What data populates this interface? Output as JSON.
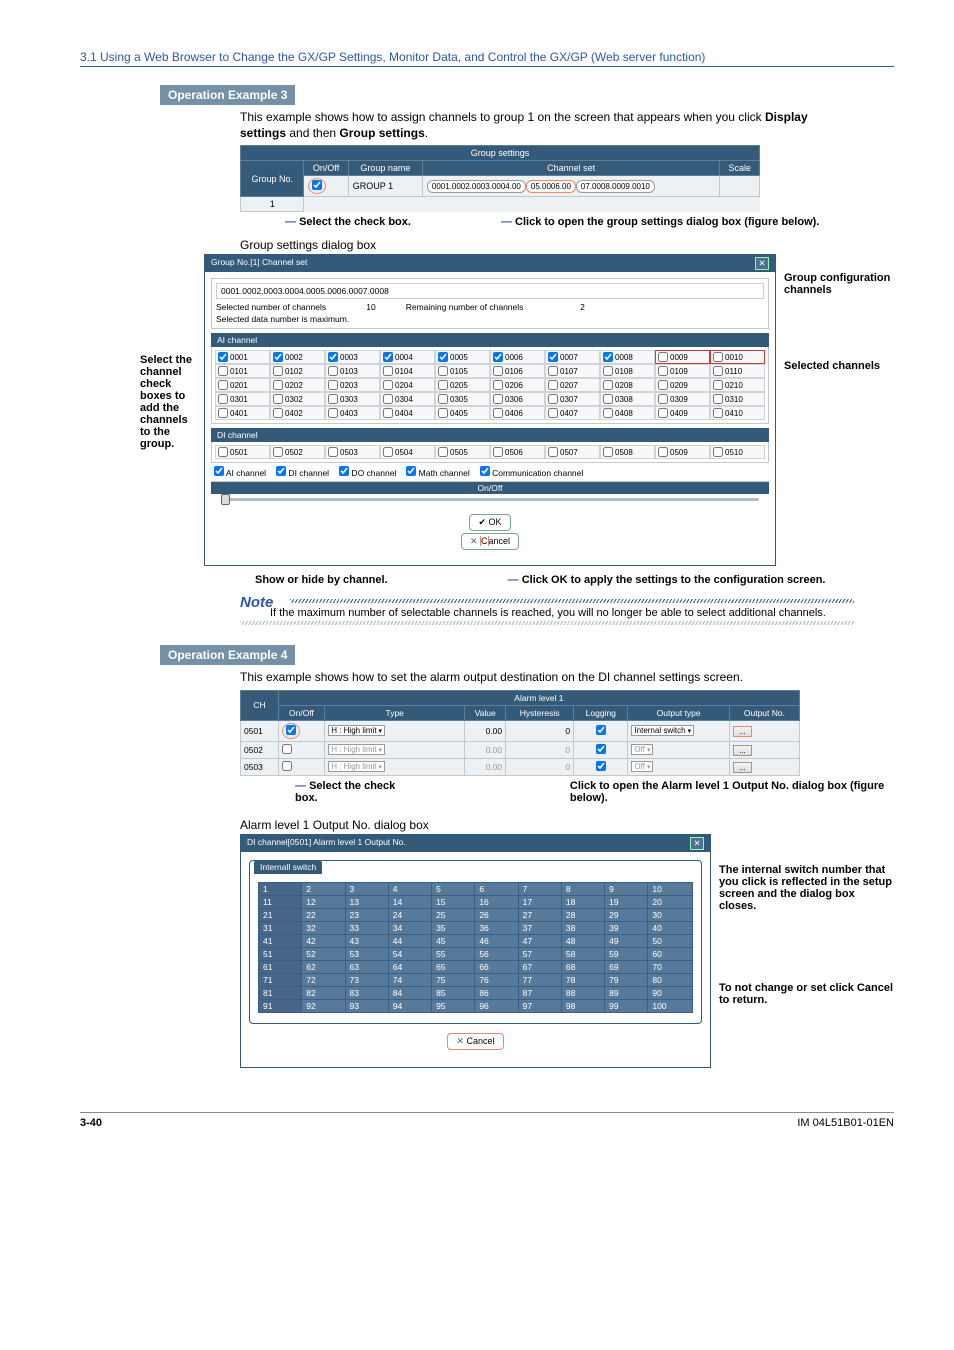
{
  "breadcrumb": "3.1  Using a Web Browser to Change the GX/GP Settings, Monitor Data, and Control the GX/GP (Web server function)",
  "ex3": {
    "header": "Operation Example 3",
    "intro_a": "This example shows how to assign channels to group 1 on the screen that appears when you click ",
    "intro_b": "Display settings",
    "intro_c": " and then ",
    "intro_d": "Group settings",
    "intro_e": ".",
    "top_table": {
      "title": "Group settings",
      "cols": [
        "Group No.",
        "On/Off",
        "Group name",
        "Channel set",
        "Scale"
      ],
      "row": {
        "no": "1",
        "name": "GROUP 1",
        "chan_a": "0001.0002.0003.0004.00",
        "chan_b": "05.0006.00",
        "chan_c": "07.0008.0009.0010"
      }
    },
    "callout_select": "Select the check box.",
    "callout_click": "Click to open the group settings dialog box (figure below).",
    "dialog_caption": "Group settings dialog box",
    "side_label": "Select the channel check boxes to add the channels to the group.",
    "right_group": "Group configuration channels",
    "right_selected": "Selected channels",
    "dlg": {
      "title": "Group No.[1] Channel set",
      "selstring": "0001.0002.0003.0004.0005.0006.0007.0008",
      "sel_label": "Selected number of channels",
      "sel_val": "10",
      "rem_label": "Remaining number of channels",
      "rem_val": "2",
      "max_note": "Selected data number is maximum.",
      "ai": "AI channel",
      "di": "DI channel",
      "filters": [
        "AI channel",
        "DI channel",
        "DO channel",
        "Math channel",
        "Communication channel"
      ],
      "onoff": "On/Off",
      "ok": "OK",
      "cancel": "Cancel",
      "ai_rows": [
        [
          "0001",
          "0002",
          "0003",
          "0004",
          "0005",
          "0006",
          "0007",
          "0008",
          "0009",
          "0010"
        ],
        [
          "0101",
          "0102",
          "0103",
          "0104",
          "0105",
          "0106",
          "0107",
          "0108",
          "0109",
          "0110"
        ],
        [
          "0201",
          "0202",
          "0203",
          "0204",
          "0205",
          "0206",
          "0207",
          "0208",
          "0209",
          "0210"
        ],
        [
          "0301",
          "0302",
          "0303",
          "0304",
          "0305",
          "0306",
          "0307",
          "0308",
          "0309",
          "0310"
        ],
        [
          "0401",
          "0402",
          "0403",
          "0404",
          "0405",
          "0406",
          "0407",
          "0408",
          "0409",
          "0410"
        ]
      ],
      "di_row": [
        "0501",
        "0502",
        "0503",
        "0504",
        "0505",
        "0506",
        "0507",
        "0508",
        "0509",
        "0510"
      ]
    },
    "show_hide": "Show or hide by channel.",
    "click_ok": "Click OK to apply the settings to the configuration screen."
  },
  "note": {
    "head": "Note",
    "body": "If the maximum number of selectable channels is reached, you will no longer be able to select additional channels."
  },
  "ex4": {
    "header": "Operation Example 4",
    "intro": "This example shows how to set the alarm output destination on the DI channel settings screen.",
    "tbl": {
      "group": "Alarm level 1",
      "cols": [
        "CH",
        "On/Off",
        "Type",
        "Value",
        "Hysteresis",
        "Logging",
        "Output type",
        "Output No."
      ],
      "rows": [
        {
          "ch": "0501",
          "type": "H : High limit",
          "val": "0.00",
          "hys": "0",
          "out": "Internal switch"
        },
        {
          "ch": "0502",
          "type": "H : High limit",
          "val": "0.00",
          "hys": "0",
          "out": "Off"
        },
        {
          "ch": "0503",
          "type": "H : High limit",
          "val": "0.00",
          "hys": "0",
          "out": "Off"
        }
      ]
    },
    "callout_select": "Select the check box.",
    "callout_click": "Click to open the Alarm level 1 Output No. dialog box (figure below).",
    "dlg_caption": "Alarm level 1 Output No. dialog box",
    "dlg": {
      "title": "DI channel[0501] Alarm level 1 Output No.",
      "tab": "Internall switch",
      "cancel": "Cancel"
    },
    "right1": "The internal switch number that you click is reflected in the setup screen and the dialog box closes.",
    "right2": "To not change or set click Cancel to return."
  },
  "footer": {
    "page": "3-40",
    "doc": "IM 04L51B01-01EN"
  }
}
